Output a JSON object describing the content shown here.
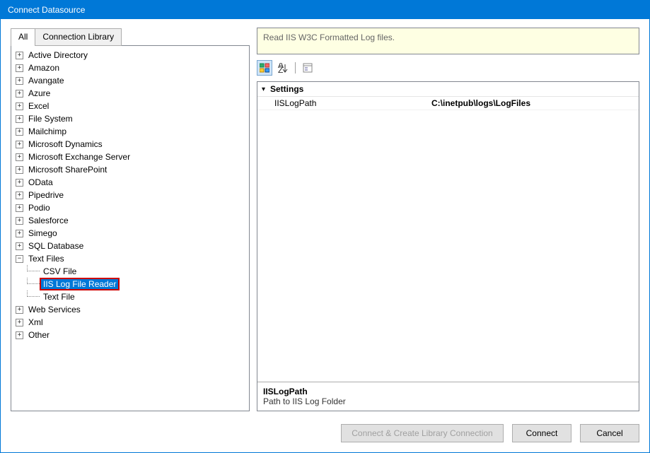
{
  "window": {
    "title": "Connect Datasource"
  },
  "tabs": {
    "all": "All",
    "library": "Connection Library"
  },
  "tree": {
    "items": [
      {
        "label": "Active Directory",
        "expanded": false
      },
      {
        "label": "Amazon",
        "expanded": false
      },
      {
        "label": "Avangate",
        "expanded": false
      },
      {
        "label": "Azure",
        "expanded": false
      },
      {
        "label": "Excel",
        "expanded": false
      },
      {
        "label": "File System",
        "expanded": false
      },
      {
        "label": "Mailchimp",
        "expanded": false
      },
      {
        "label": "Microsoft Dynamics",
        "expanded": false
      },
      {
        "label": "Microsoft Exchange Server",
        "expanded": false
      },
      {
        "label": "Microsoft SharePoint",
        "expanded": false
      },
      {
        "label": "OData",
        "expanded": false
      },
      {
        "label": "Pipedrive",
        "expanded": false
      },
      {
        "label": "Podio",
        "expanded": false
      },
      {
        "label": "Salesforce",
        "expanded": false
      },
      {
        "label": "Simego",
        "expanded": false
      },
      {
        "label": "SQL Database",
        "expanded": false
      },
      {
        "label": "Text Files",
        "expanded": true,
        "children": [
          "CSV File",
          "IIS Log File Reader",
          "Text File"
        ],
        "selectedChild": 1
      },
      {
        "label": "Web Services",
        "expanded": false
      },
      {
        "label": "Xml",
        "expanded": false
      },
      {
        "label": "Other",
        "expanded": false
      }
    ]
  },
  "description": "Read IIS W3C Formatted Log files.",
  "propgrid": {
    "section": "Settings",
    "rows": [
      {
        "key": "IISLogPath",
        "val": "C:\\inetpub\\logs\\LogFiles"
      }
    ],
    "footer": {
      "title": "IISLogPath",
      "desc": "Path to IIS Log Folder"
    }
  },
  "buttons": {
    "create_lib": "Connect & Create Library Connection",
    "connect": "Connect",
    "cancel": "Cancel"
  }
}
